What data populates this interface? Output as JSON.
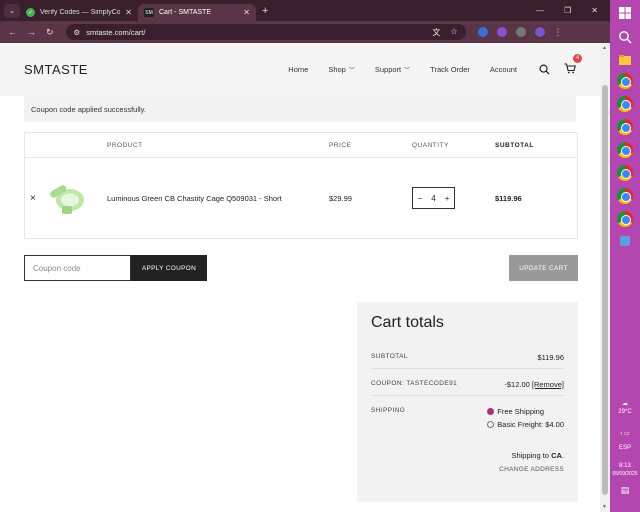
{
  "browser": {
    "tabs": [
      {
        "title": "Verify Codes — SimplyCodes",
        "favicon": "check-icon",
        "active": false
      },
      {
        "title": "Cart - SMTASTE",
        "favicon_text": "SM",
        "active": true
      }
    ],
    "url": "smtaste.com/cart/"
  },
  "site": {
    "logo": "SMTASTE",
    "nav": [
      {
        "label": "Home"
      },
      {
        "label": "Shop"
      },
      {
        "label": "Support"
      },
      {
        "label": "Track Order"
      },
      {
        "label": "Account"
      }
    ],
    "cart_count": "4"
  },
  "notice": "Coupon code applied successfully.",
  "cart": {
    "headers": {
      "product": "PRODUCT",
      "price": "PRICE",
      "quantity": "QUANTITY",
      "subtotal": "SUBTOTAL"
    },
    "items": [
      {
        "remove": "×",
        "name": "Luminous Green CB Chastity Cage Q509031 - Short",
        "price": "$29.99",
        "quantity": "4",
        "subtotal": "$119.96"
      }
    ],
    "coupon_placeholder": "Coupon code",
    "apply_label": "APPLY COUPON",
    "update_label": "UPDATE CART"
  },
  "totals": {
    "title": "Cart totals",
    "subtotal_label": "SUBTOTAL",
    "subtotal_value": "$119.96",
    "coupon_label": "COUPON: TASTECODE91",
    "coupon_value": "-$12.00",
    "coupon_remove": "[Remove]",
    "shipping_label": "SHIPPING",
    "shipping_options": [
      {
        "label": "Free Shipping",
        "selected": true
      },
      {
        "label": "Basic Freight: $4.00",
        "selected": false
      }
    ],
    "ship_to_prefix": "Shipping to",
    "ship_to_country": "CA",
    "change_address": "CHANGE ADDRESS"
  },
  "taskbar": {
    "weather_temp": "29°C",
    "language": "ESP",
    "time": "8:13",
    "date": "05/09/2025"
  },
  "colors": {
    "browser_frame": "#3a1f2e",
    "taskbar": "#b446b0",
    "accent_button": "#222222",
    "update_button": "#999999",
    "cart_badge": "#e04848"
  }
}
